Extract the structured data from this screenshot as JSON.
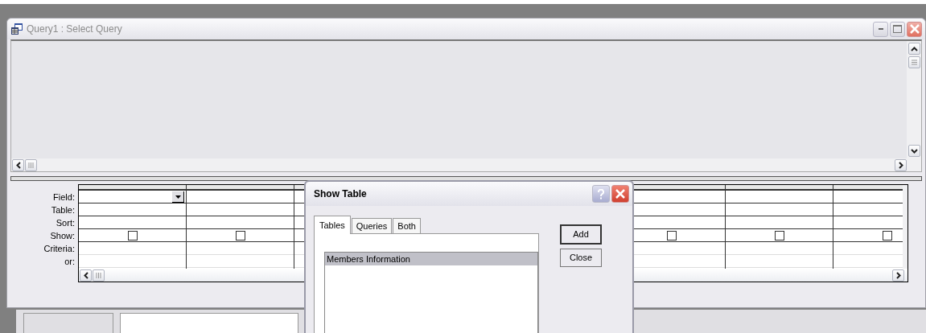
{
  "window": {
    "title": "Query1 : Select Query"
  },
  "grid": {
    "row_labels": [
      "Field:",
      "Table:",
      "Sort:",
      "Show:",
      "Criteria:",
      "or:"
    ],
    "left_columns": [
      {
        "current": true,
        "show_checked": false
      },
      {
        "current": false,
        "show_checked": false
      }
    ],
    "right_columns": [
      {
        "current": false,
        "show_checked": false
      },
      {
        "current": false,
        "show_checked": false
      },
      {
        "show_checked": false
      }
    ]
  },
  "dialog": {
    "title": "Show Table",
    "tabs": [
      {
        "label": "Tables",
        "selected": true
      },
      {
        "label": "Queries",
        "selected": false
      },
      {
        "label": "Both",
        "selected": false
      }
    ],
    "items": [
      {
        "label": "Members Information",
        "selected": true
      }
    ],
    "buttons": [
      {
        "label": "Add",
        "default": true
      },
      {
        "label": "Close",
        "default": false
      }
    ]
  }
}
